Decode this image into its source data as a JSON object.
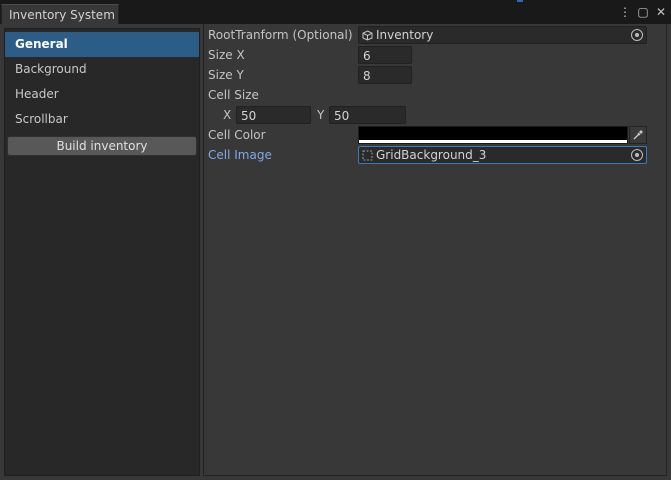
{
  "window": {
    "tab_title": "Inventory System",
    "menu_icon": "⋮",
    "maximize_icon": "▢",
    "close_icon": "✕"
  },
  "sidebar": {
    "items": [
      {
        "label": "General",
        "active": true
      },
      {
        "label": "Background",
        "active": false
      },
      {
        "label": "Header",
        "active": false
      },
      {
        "label": "Scrollbar",
        "active": false
      }
    ],
    "build_button": "Build inventory"
  },
  "properties": {
    "root_transform": {
      "label": "RootTranform (Optional)",
      "value": "Inventory",
      "icon": "cube-icon"
    },
    "size_x": {
      "label": "Size X",
      "value": "6"
    },
    "size_y": {
      "label": "Size Y",
      "value": "8"
    },
    "cell_size": {
      "label": "Cell Size",
      "x_label": "X",
      "x_value": "50",
      "y_label": "Y",
      "y_value": "50"
    },
    "cell_color": {
      "label": "Cell Color",
      "color": "#000000",
      "icon": "eyedropper-icon"
    },
    "cell_image": {
      "label": "Cell Image",
      "value": "GridBackground_3",
      "icon": "sprite-icon"
    }
  },
  "colors": {
    "accent": "#2c5d87",
    "link_label": "#7faae8",
    "focus_border": "#3a79bb"
  }
}
